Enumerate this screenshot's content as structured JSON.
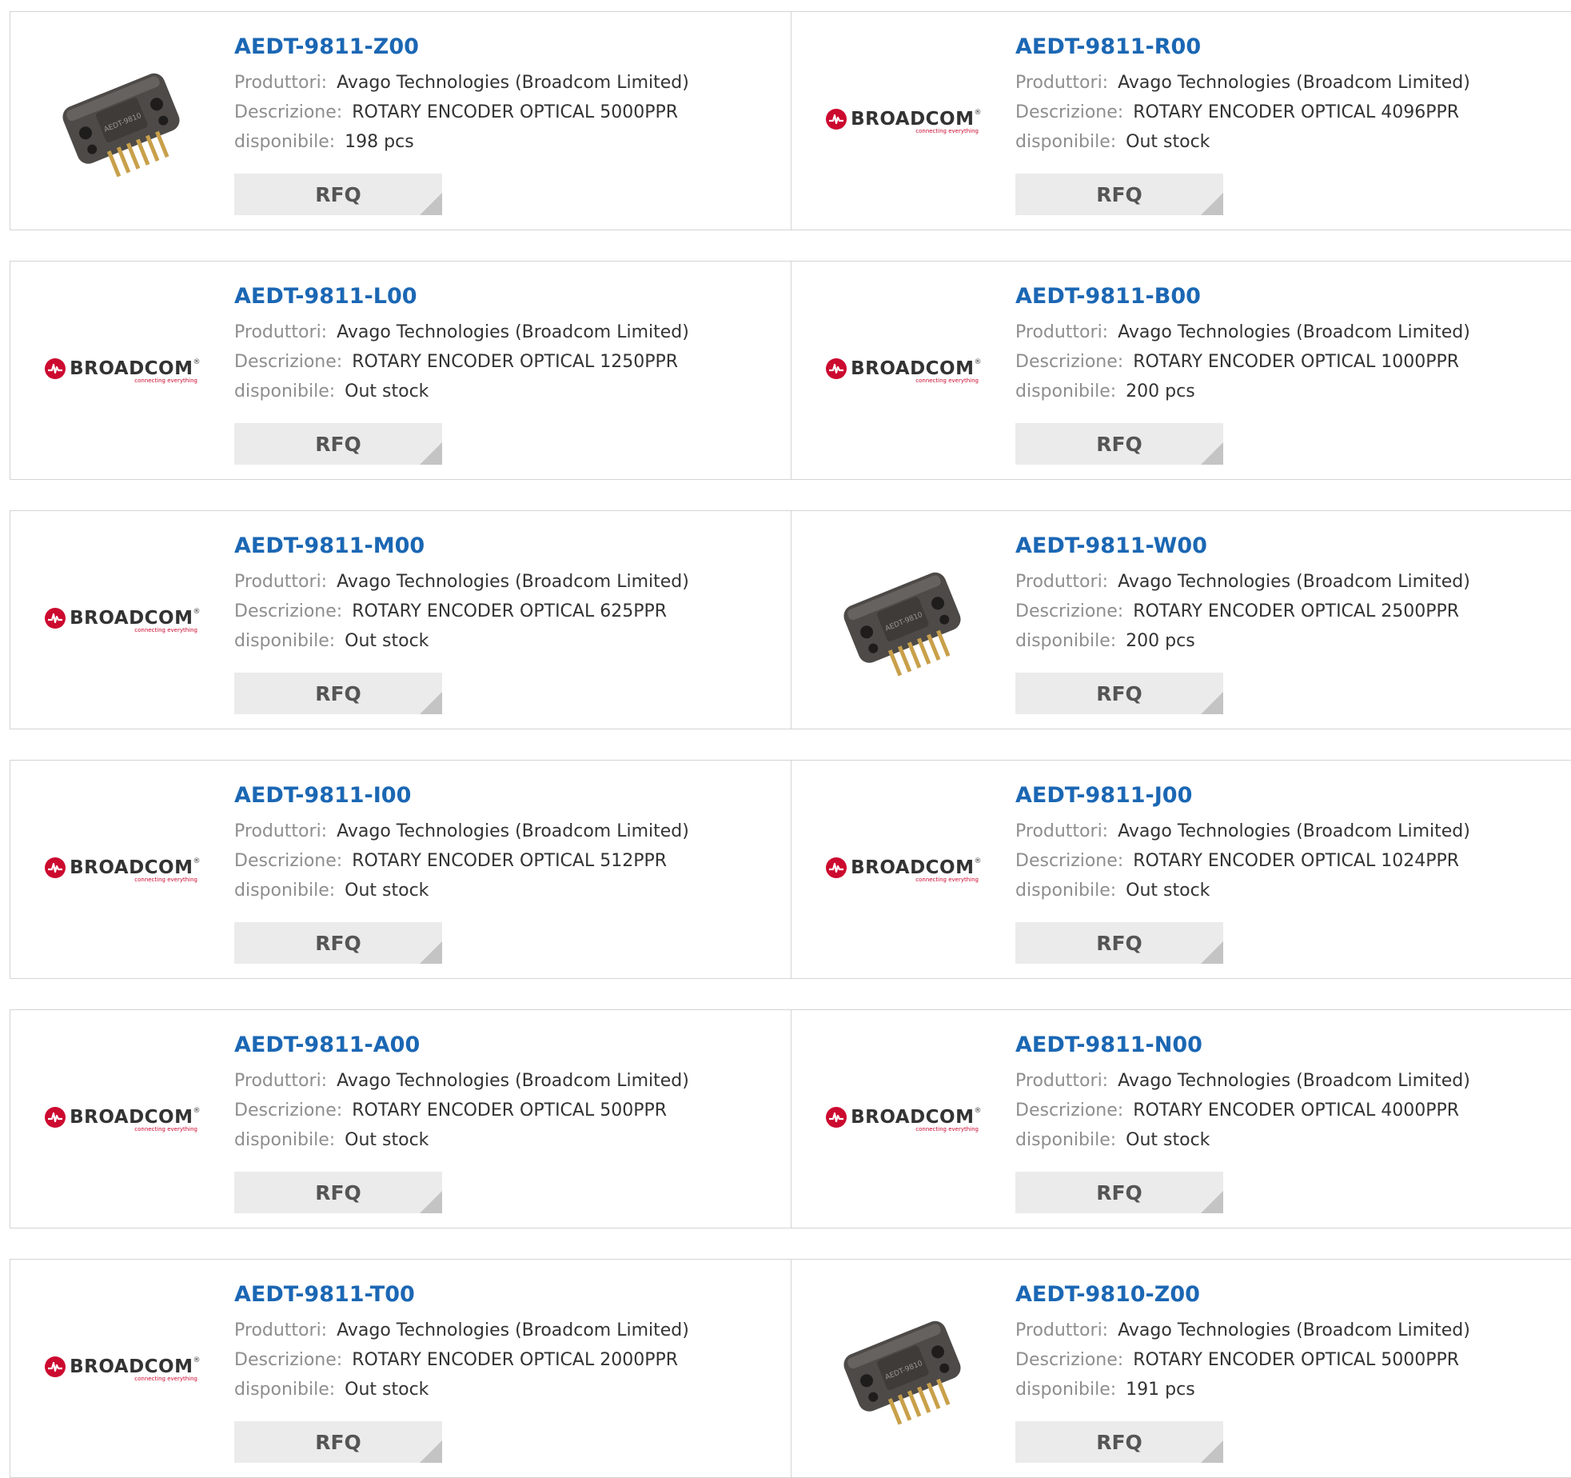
{
  "labels": {
    "manufacturer": "Produttori:",
    "description": "Descrizione:",
    "availability": "disponibile:",
    "rfq": "RFQ"
  },
  "brand_logo": {
    "text": "BROADCOM",
    "tagline": "connecting everything",
    "color": "#cc092f"
  },
  "colors": {
    "part_link": "#1b67b4",
    "label": "#8e8e8e",
    "value": "#333333",
    "button_bg": "#ebebeb"
  },
  "products": [
    {
      "part_number": "AEDT-9811-Z00",
      "manufacturer": "Avago Technologies (Broadcom Limited)",
      "description": "ROTARY ENCODER OPTICAL 5000PPR",
      "availability": "198 pcs",
      "image": "encoder-photo"
    },
    {
      "part_number": "AEDT-9811-R00",
      "manufacturer": "Avago Technologies (Broadcom Limited)",
      "description": "ROTARY ENCODER OPTICAL 4096PPR",
      "availability": "Out stock",
      "image": "broadcom-logo"
    },
    {
      "part_number": "AEDT-9811-L00",
      "manufacturer": "Avago Technologies (Broadcom Limited)",
      "description": "ROTARY ENCODER OPTICAL 1250PPR",
      "availability": "Out stock",
      "image": "broadcom-logo"
    },
    {
      "part_number": "AEDT-9811-B00",
      "manufacturer": "Avago Technologies (Broadcom Limited)",
      "description": "ROTARY ENCODER OPTICAL 1000PPR",
      "availability": "200 pcs",
      "image": "broadcom-logo"
    },
    {
      "part_number": "AEDT-9811-M00",
      "manufacturer": "Avago Technologies (Broadcom Limited)",
      "description": "ROTARY ENCODER OPTICAL 625PPR",
      "availability": "Out stock",
      "image": "broadcom-logo"
    },
    {
      "part_number": "AEDT-9811-W00",
      "manufacturer": "Avago Technologies (Broadcom Limited)",
      "description": "ROTARY ENCODER OPTICAL 2500PPR",
      "availability": "200 pcs",
      "image": "encoder-photo"
    },
    {
      "part_number": "AEDT-9811-I00",
      "manufacturer": "Avago Technologies (Broadcom Limited)",
      "description": "ROTARY ENCODER OPTICAL 512PPR",
      "availability": "Out stock",
      "image": "broadcom-logo"
    },
    {
      "part_number": "AEDT-9811-J00",
      "manufacturer": "Avago Technologies (Broadcom Limited)",
      "description": "ROTARY ENCODER OPTICAL 1024PPR",
      "availability": "Out stock",
      "image": "broadcom-logo"
    },
    {
      "part_number": "AEDT-9811-A00",
      "manufacturer": "Avago Technologies (Broadcom Limited)",
      "description": "ROTARY ENCODER OPTICAL 500PPR",
      "availability": "Out stock",
      "image": "broadcom-logo"
    },
    {
      "part_number": "AEDT-9811-N00",
      "manufacturer": "Avago Technologies (Broadcom Limited)",
      "description": "ROTARY ENCODER OPTICAL 4000PPR",
      "availability": "Out stock",
      "image": "broadcom-logo"
    },
    {
      "part_number": "AEDT-9811-T00",
      "manufacturer": "Avago Technologies (Broadcom Limited)",
      "description": "ROTARY ENCODER OPTICAL 2000PPR",
      "availability": "Out stock",
      "image": "broadcom-logo"
    },
    {
      "part_number": "AEDT-9810-Z00",
      "manufacturer": "Avago Technologies (Broadcom Limited)",
      "description": "ROTARY ENCODER OPTICAL 5000PPR",
      "availability": "191 pcs",
      "image": "encoder-photo"
    }
  ]
}
